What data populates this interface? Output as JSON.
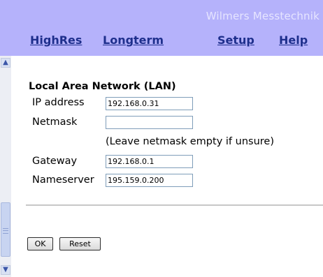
{
  "header": {
    "brand": "Wilmers Messtechnik",
    "nav": [
      "HighRes",
      "Longterm",
      "Setup",
      "Help"
    ]
  },
  "section_title": "Local Area Network (LAN)",
  "form": {
    "ip_label": "IP address",
    "ip_value": "192.168.0.31",
    "netmask_label": "Netmask",
    "netmask_value": "",
    "netmask_hint": "(Leave netmask empty if unsure)",
    "gateway_label": "Gateway",
    "gateway_value": "192.168.0.1",
    "nameserver_label": "Nameserver",
    "nameserver_value": "195.159.0.200"
  },
  "buttons": {
    "ok": "OK",
    "reset": "Reset"
  },
  "scrollbar": {
    "up_icon": "▲",
    "down_icon": "▼"
  },
  "colors": {
    "header_bg": "#b5b2fb",
    "nav_link": "#1e2f8c",
    "brand_text": "#e6e5ff"
  }
}
